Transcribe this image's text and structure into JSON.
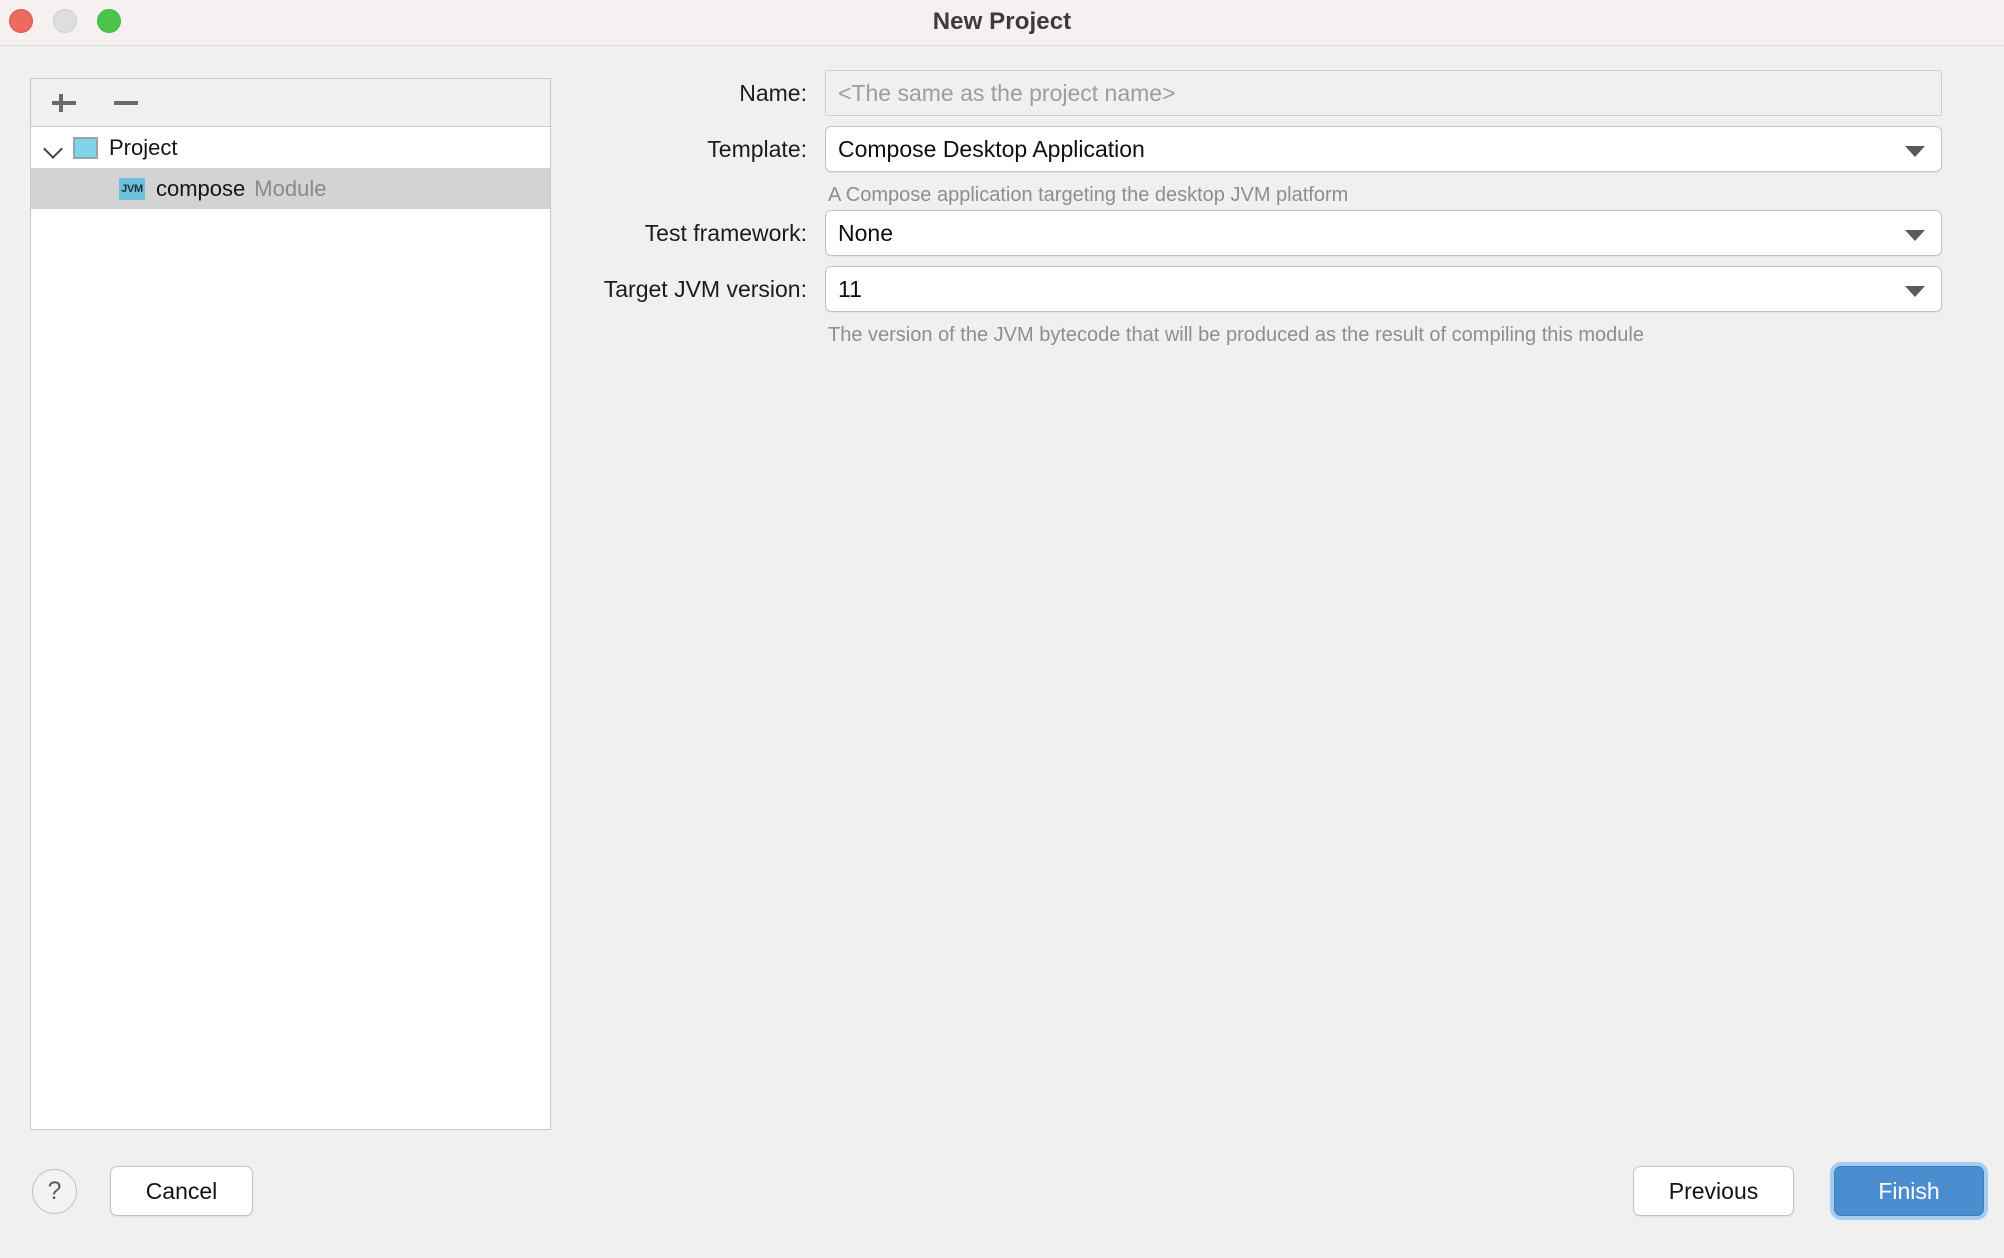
{
  "window": {
    "title": "New Project",
    "traffic_lights": [
      {
        "name": "close",
        "color": "#ec6a5e"
      },
      {
        "name": "minimize",
        "color": "#dedede"
      },
      {
        "name": "zoom",
        "color": "#4cc44c"
      }
    ]
  },
  "tree_panel": {
    "toolbar": {
      "add_label": "+",
      "remove_label": "−"
    },
    "nodes": [
      {
        "label": "Project",
        "sub": "",
        "icon": "project-icon",
        "expanded": true,
        "selected": false
      },
      {
        "label": "compose",
        "sub": "Module",
        "icon": "jvm-icon",
        "icon_text": "JVM",
        "expanded": false,
        "selected": true
      }
    ]
  },
  "form": {
    "name": {
      "label": "Name:",
      "value": "",
      "placeholder": "<The same as the project name>"
    },
    "template": {
      "label": "Template:",
      "value": "Compose Desktop Application",
      "hint": "A Compose application targeting the desktop JVM platform"
    },
    "test_framework": {
      "label": "Test framework:",
      "value": "None",
      "hint": ""
    },
    "target_jvm_version": {
      "label": "Target JVM version:",
      "value": "11",
      "hint": "The version of the JVM bytecode that will be produced as the result of compiling this module"
    }
  },
  "footer": {
    "help_label": "?",
    "cancel_label": "Cancel",
    "previous_label": "Previous",
    "finish_label": "Finish",
    "finish_accent_color": "#4a8ed0"
  }
}
